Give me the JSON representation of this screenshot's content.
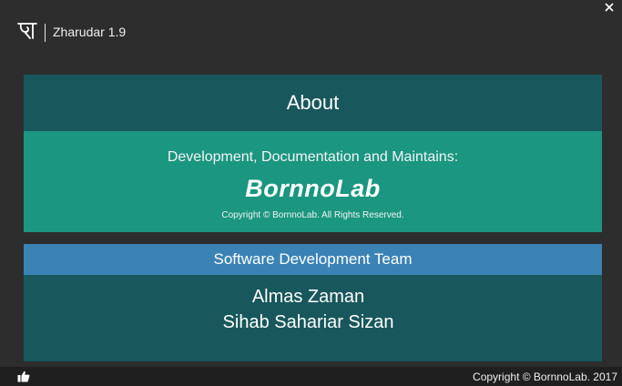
{
  "window": {
    "title": "Zharudar 1.9",
    "logo_icon": "bengali-letter-logo-icon",
    "close_icon": "close-icon",
    "close_label": "×"
  },
  "about": {
    "title": "About",
    "dev_label": "Development, Documentation and Maintains:",
    "brand": "BornnoLab",
    "copyright": "Copyright © BornnoLab. All Rights Reserved."
  },
  "team": {
    "title": "Software Development Team",
    "members": [
      "Almas Zaman",
      "Sihab Sahariar Sizan"
    ]
  },
  "statusbar": {
    "like_icon": "thumbs-up-icon",
    "copyright": "Copyright © BornnoLab. 2017"
  },
  "colors": {
    "background": "#2d2d2d",
    "header_dark_teal": "#18575c",
    "body_teal": "#1b9680",
    "team_blue": "#3a83b4",
    "statusbar": "#1f1f1f"
  }
}
